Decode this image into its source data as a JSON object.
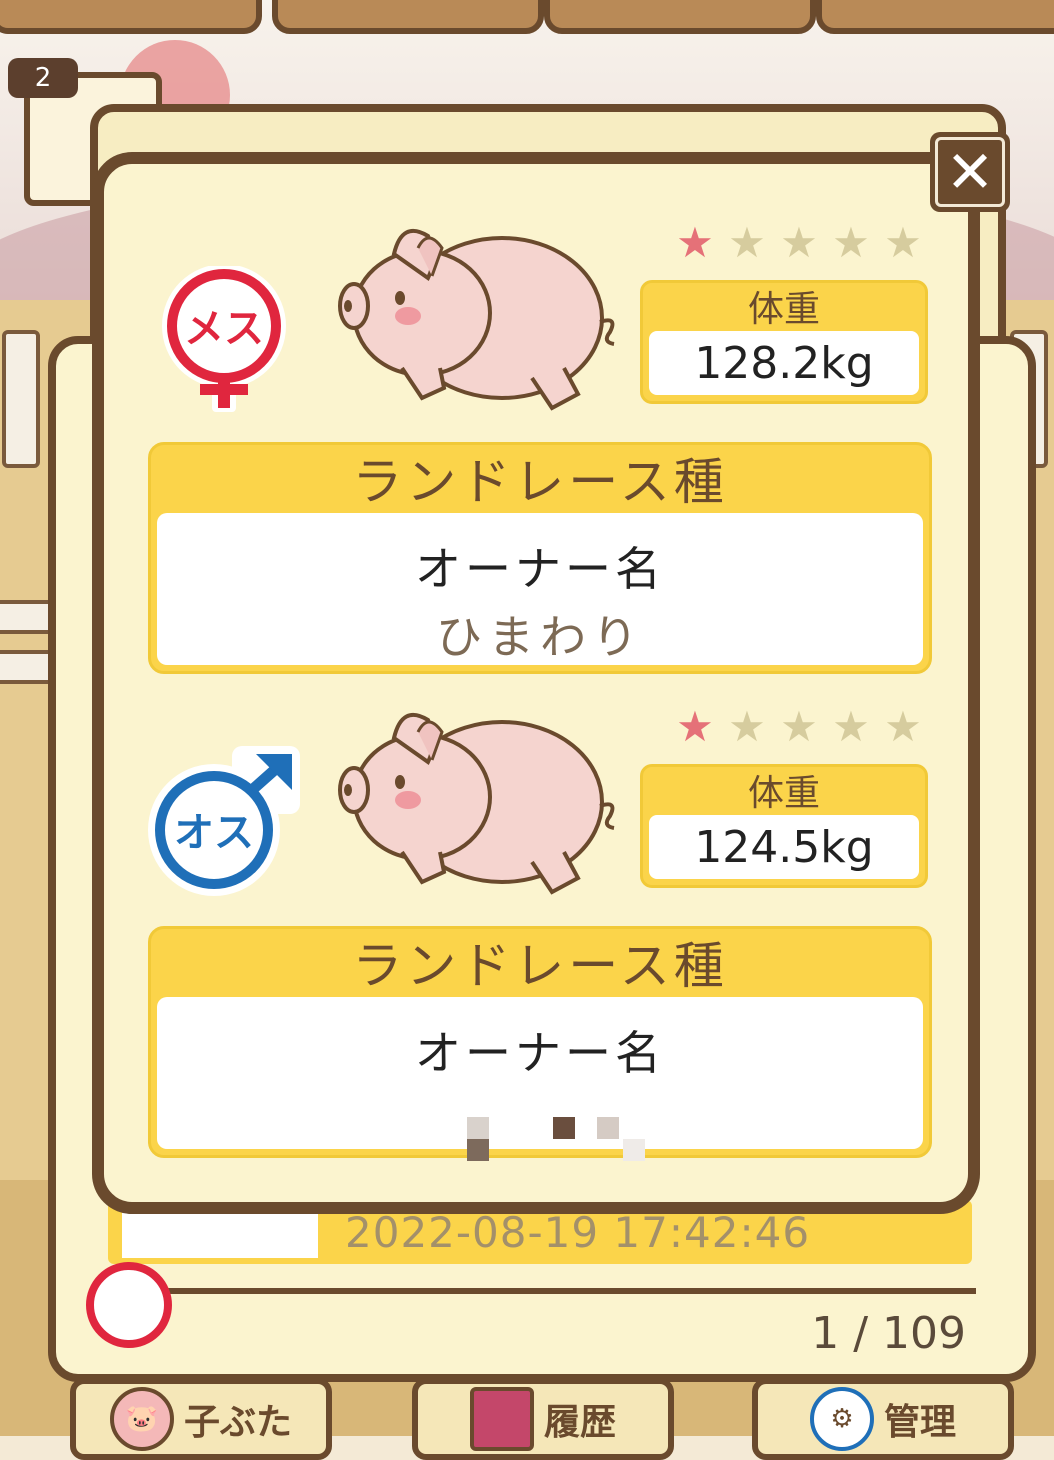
{
  "background": {
    "corner_badge": "2",
    "list_timestamp": "2022-08-19 17:42:46",
    "page_counter": "1 / 109",
    "nav": [
      {
        "label": "子ぶた",
        "icon": "pig-face-icon"
      },
      {
        "label": "履歴",
        "icon": "book-icon"
      },
      {
        "label": "管理",
        "icon": "gear-icon"
      }
    ]
  },
  "dialog": {
    "close_label": "✕",
    "pigs": [
      {
        "sex": "メス",
        "sex_icon": "female-symbol-icon",
        "stars_filled": 1,
        "stars_total": 5,
        "weight_label": "体重",
        "weight_value": "128.2kg",
        "breed": "ランドレース種",
        "owner_label": "オーナー名",
        "owner_name": "ひまわり"
      },
      {
        "sex": "オス",
        "sex_icon": "male-symbol-icon",
        "stars_filled": 1,
        "stars_total": 5,
        "weight_label": "体重",
        "weight_value": "124.5kg",
        "breed": "ランドレース種",
        "owner_label": "オーナー名",
        "owner_name": ""
      }
    ]
  },
  "colors": {
    "panel_bg": "#fbf4cf",
    "frame": "#6a4a2d",
    "accent_yellow": "#fbd44a",
    "female_red": "#e0263e",
    "male_blue": "#1f6fb8",
    "star_on": "#e57178",
    "star_off": "#d6cc9e"
  }
}
